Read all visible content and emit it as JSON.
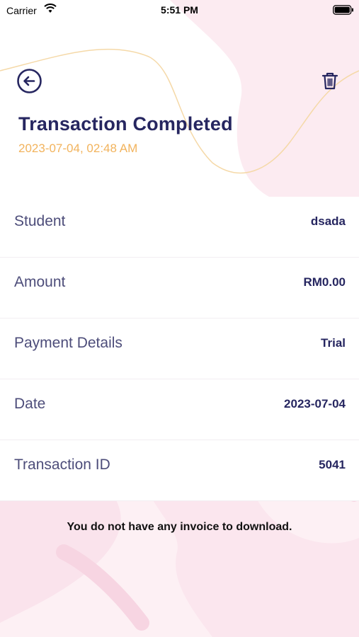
{
  "status_bar": {
    "carrier": "Carrier",
    "time": "5:51 PM"
  },
  "header": {
    "back_icon": "arrow-left-circle-icon",
    "delete_icon": "trash-icon",
    "title": "Transaction Completed",
    "timestamp": "2023-07-04, 02:48 AM"
  },
  "details": [
    {
      "label": "Student",
      "value": "dsada"
    },
    {
      "label": "Amount",
      "value": "RM0.00"
    },
    {
      "label": "Payment Details",
      "value": "Trial"
    },
    {
      "label": "Date",
      "value": "2023-07-04"
    },
    {
      "label": "Transaction ID",
      "value": "5041"
    }
  ],
  "notice": "You do not have any invoice to download.",
  "colors": {
    "title": "#262660",
    "timestamp": "#f2b35c",
    "accent_pink": "#fcebf1",
    "label": "#4d4d7a"
  }
}
